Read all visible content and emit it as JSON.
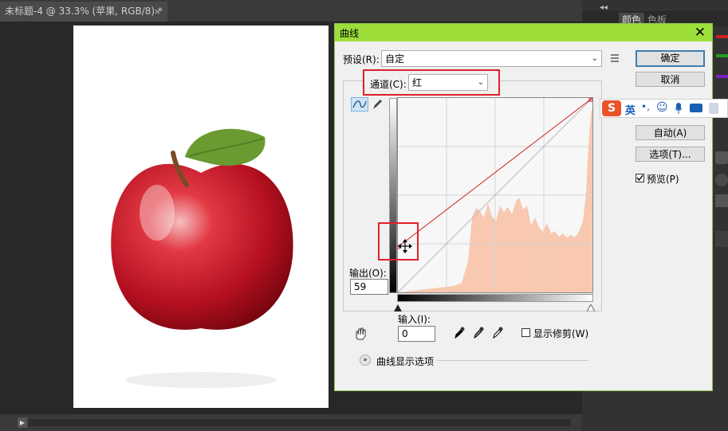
{
  "document_tab": {
    "title": "未标题-4 @ 33.3% (苹果, RGB/8) *",
    "close": "×"
  },
  "panel": {
    "collapse": "◂◂",
    "tab_color": "颜色",
    "tab_swatches": "色板"
  },
  "dialog": {
    "title": "曲线",
    "close": "✕",
    "preset_label": "预设(R):",
    "preset_value": "自定",
    "channel_label": "通道(C):",
    "channel_value": "红",
    "output_label": "输出(O):",
    "output_value": "59",
    "input_label": "输入(I):",
    "input_value": "0",
    "show_clipping_label": "显示修剪(W)",
    "curve_options_label": "曲线显示选项",
    "buttons": {
      "ok": "确定",
      "cancel": "取消",
      "auto": "自动(A)",
      "options": "选项(T)..."
    },
    "preview_label": "预览(P)",
    "preview_checked": true,
    "colors": {
      "titlebar": "#9ede3a",
      "highlight": "#e0202a",
      "curve": "#d02020",
      "histogram": "#f8c8b0"
    }
  },
  "ime": {
    "logo": "S",
    "mode": "英",
    "punct": "•,",
    "emoji": "☺",
    "mic": "🎤",
    "keyboard": "⌨"
  },
  "icons": [
    "curve-tool-icon",
    "pencil-icon",
    "hand-target-icon",
    "black-eyedropper-icon",
    "gray-eyedropper-icon",
    "white-eyedropper-icon",
    "move-cursor-icon",
    "expand-icon",
    "menu-icon"
  ]
}
